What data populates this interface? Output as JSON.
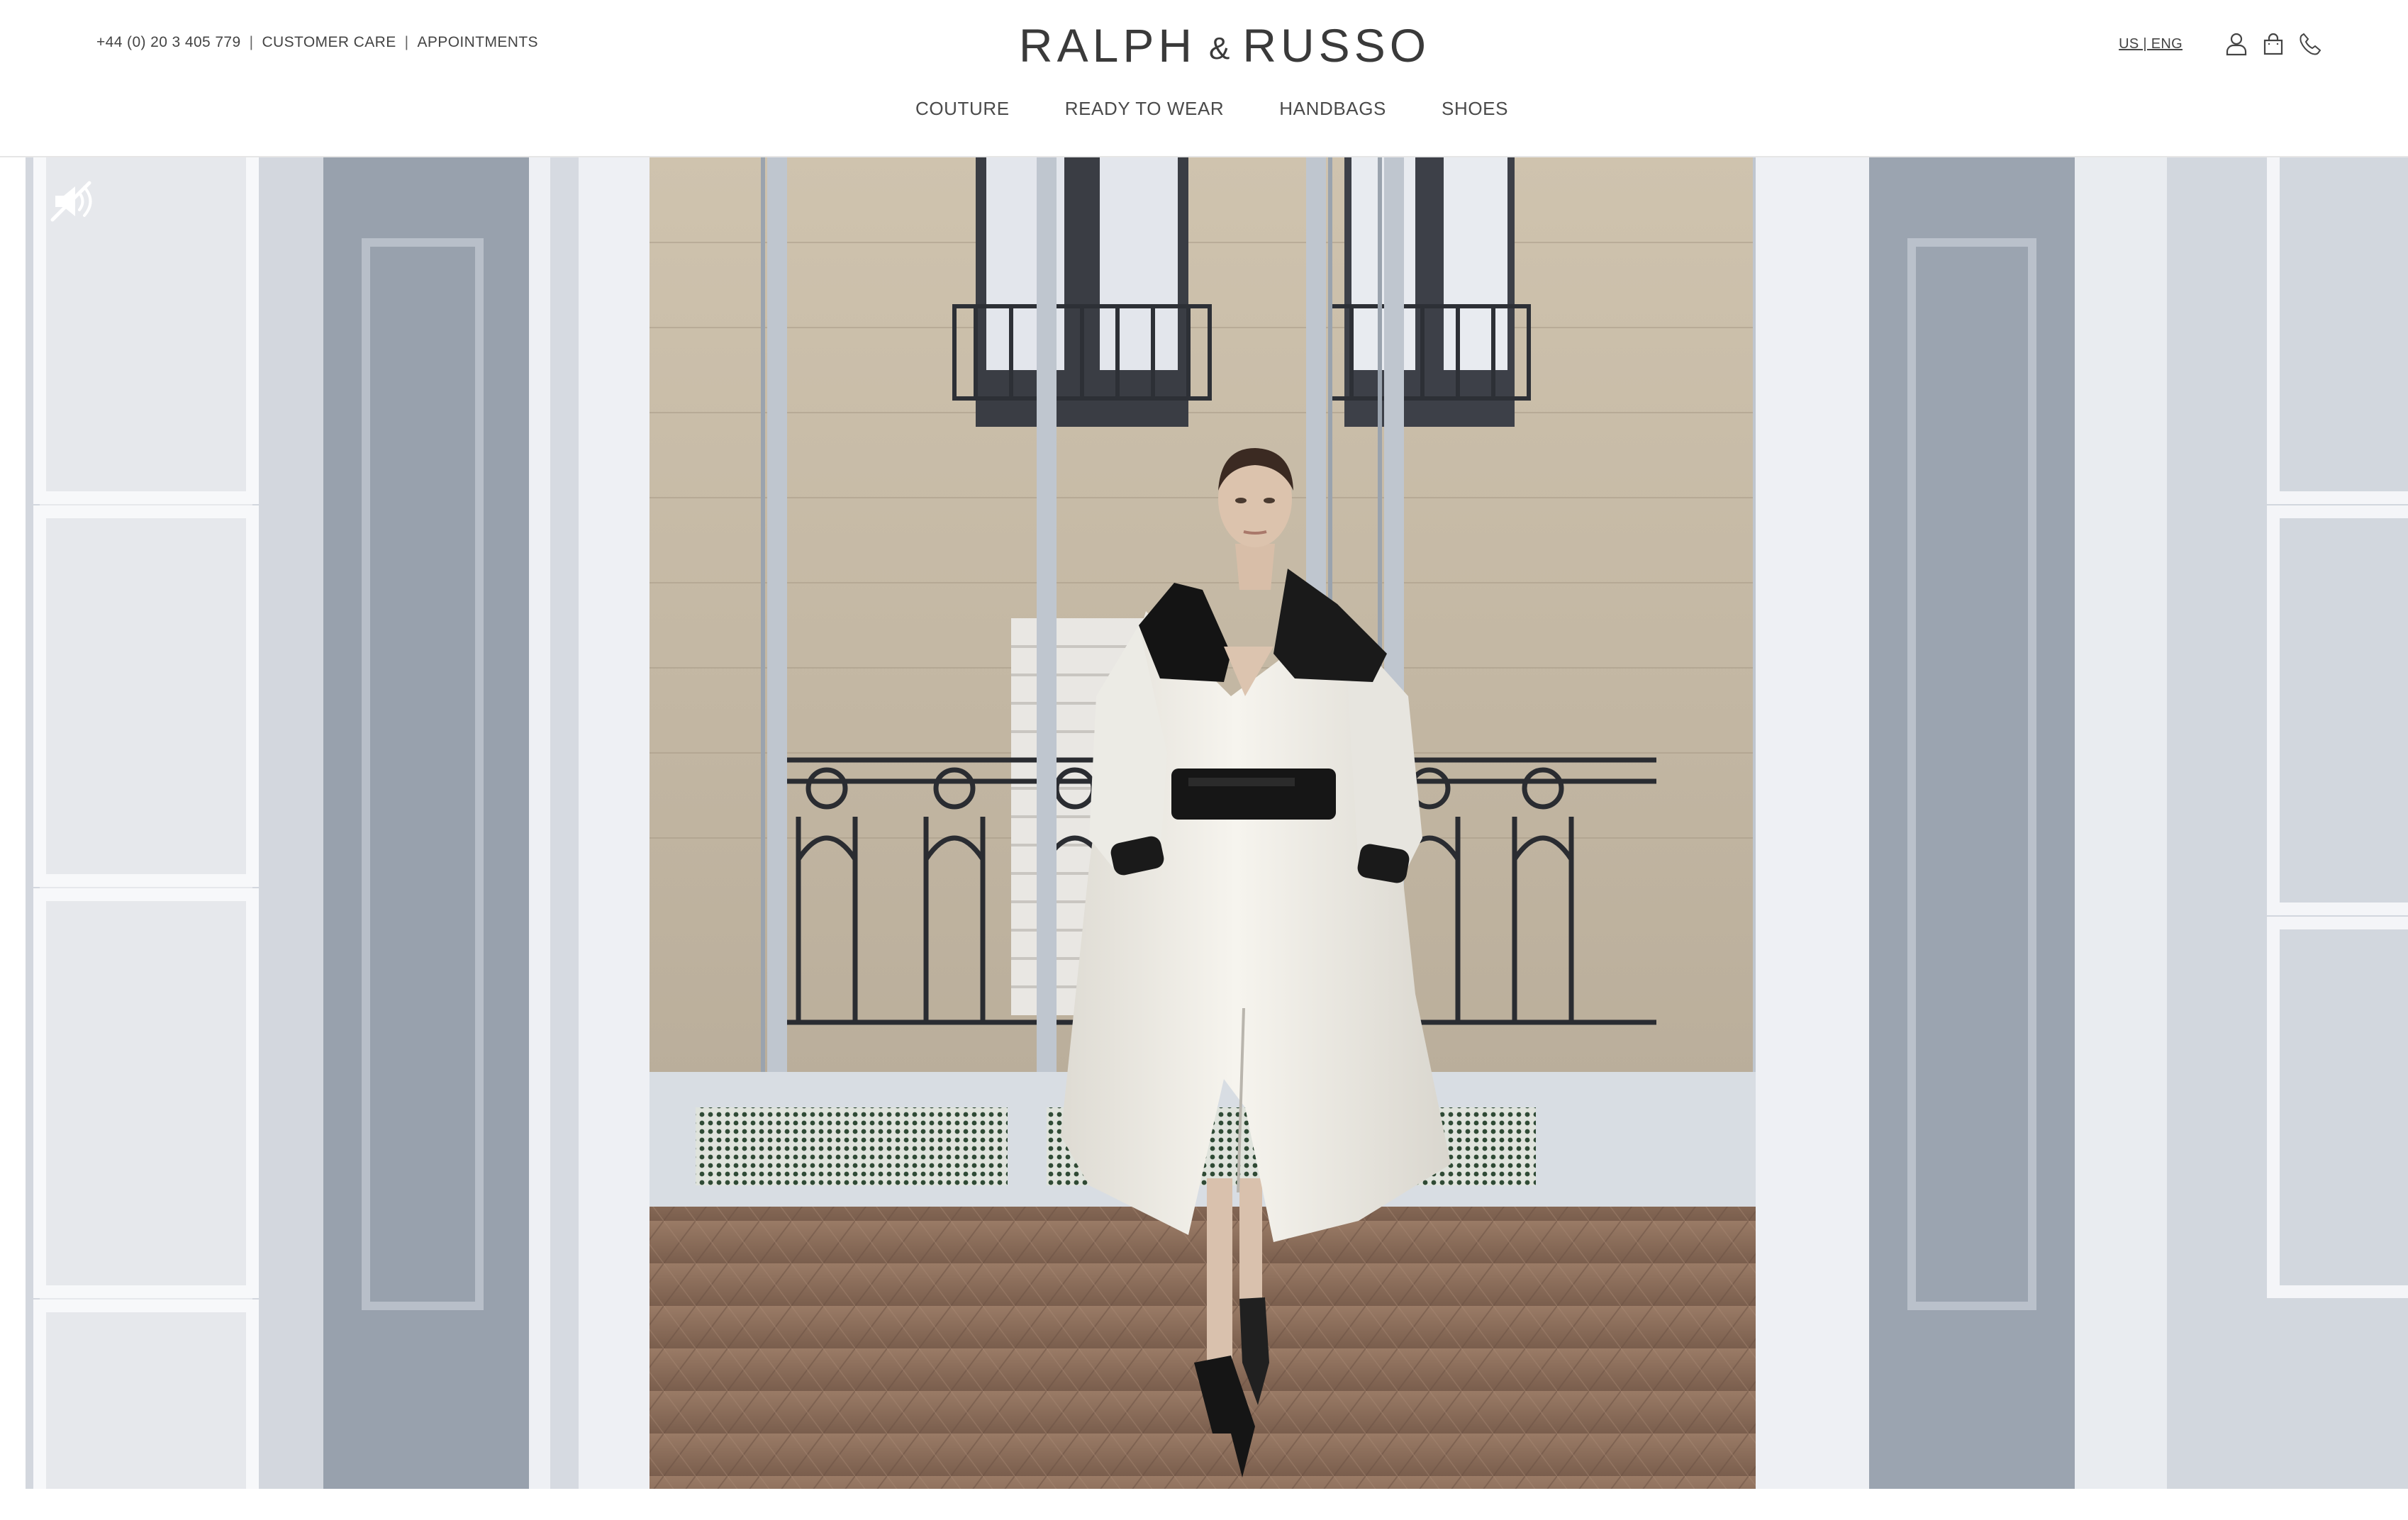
{
  "header": {
    "phone": "+44 (0) 20 3 405 779",
    "separator": "|",
    "customer_care": "CUSTOMER CARE",
    "appointments": "APPOINTMENTS",
    "logo_left": "RALPH",
    "logo_amp": "&",
    "logo_right": "RUSSO",
    "locale": "US | ENG",
    "icons": [
      "account-icon",
      "shopping-bag-icon",
      "phone-icon"
    ]
  },
  "nav": {
    "items": [
      "COUTURE",
      "READY TO WEAR",
      "HANDBAGS",
      "SHOES"
    ]
  },
  "hero": {
    "media": "runway-video",
    "controls": {
      "mute_icon": "sound-off-icon"
    },
    "colors": {
      "walls": "#aeb6c1",
      "floor": "#8a6d5b",
      "coat": "#f1efe9",
      "trim": "#1e1e1e"
    }
  }
}
